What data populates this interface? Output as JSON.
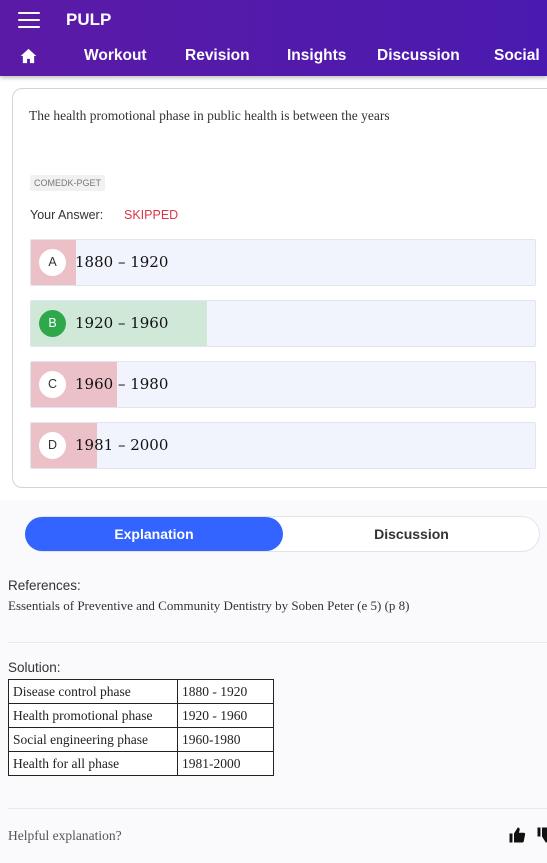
{
  "app": {
    "title": "PULP"
  },
  "nav": {
    "items": [
      "Workout",
      "Revision",
      "Insights",
      "Discussion",
      "Social"
    ]
  },
  "question": {
    "text": "The health promotional phase in public health is between the years",
    "tag": "COMEDK-PGET",
    "your_answer_label": "Your Answer:",
    "your_answer_value": "SKIPPED",
    "options": [
      {
        "letter": "A",
        "text": "1880 – 1920",
        "status": "incorrect",
        "percent": 9
      },
      {
        "letter": "B",
        "text": "1920 – 1960",
        "status": "correct",
        "percent": 35
      },
      {
        "letter": "C",
        "text": "1960 – 1980",
        "status": "incorrect",
        "percent": 17
      },
      {
        "letter": "D",
        "text": "1981 – 2000",
        "status": "incorrect",
        "percent": 13
      }
    ]
  },
  "tabs": {
    "explanation": "Explanation",
    "discussion": "Discussion",
    "active": "explanation"
  },
  "references": {
    "label": "References:",
    "text": "Essentials of Preventive and Community Dentistry by Soben Peter (e 5) (p 8)"
  },
  "solution": {
    "label": "Solution:",
    "rows": [
      [
        "Disease control phase",
        "1880 - 1920"
      ],
      [
        "Health promotional phase",
        "1920 - 1960"
      ],
      [
        "Social engineering phase",
        "1960-1980"
      ],
      [
        "Health for all phase",
        "1981-2000"
      ]
    ]
  },
  "feedback": {
    "prompt": "Helpful explanation?"
  },
  "colors": {
    "header": "#5b1aa6",
    "accent": "#3364ff",
    "correct": "#2ea84b",
    "correct_fill": "#cfe8d8",
    "incorrect_fill": "#ebc0c7",
    "skipped": "#dc3545"
  }
}
